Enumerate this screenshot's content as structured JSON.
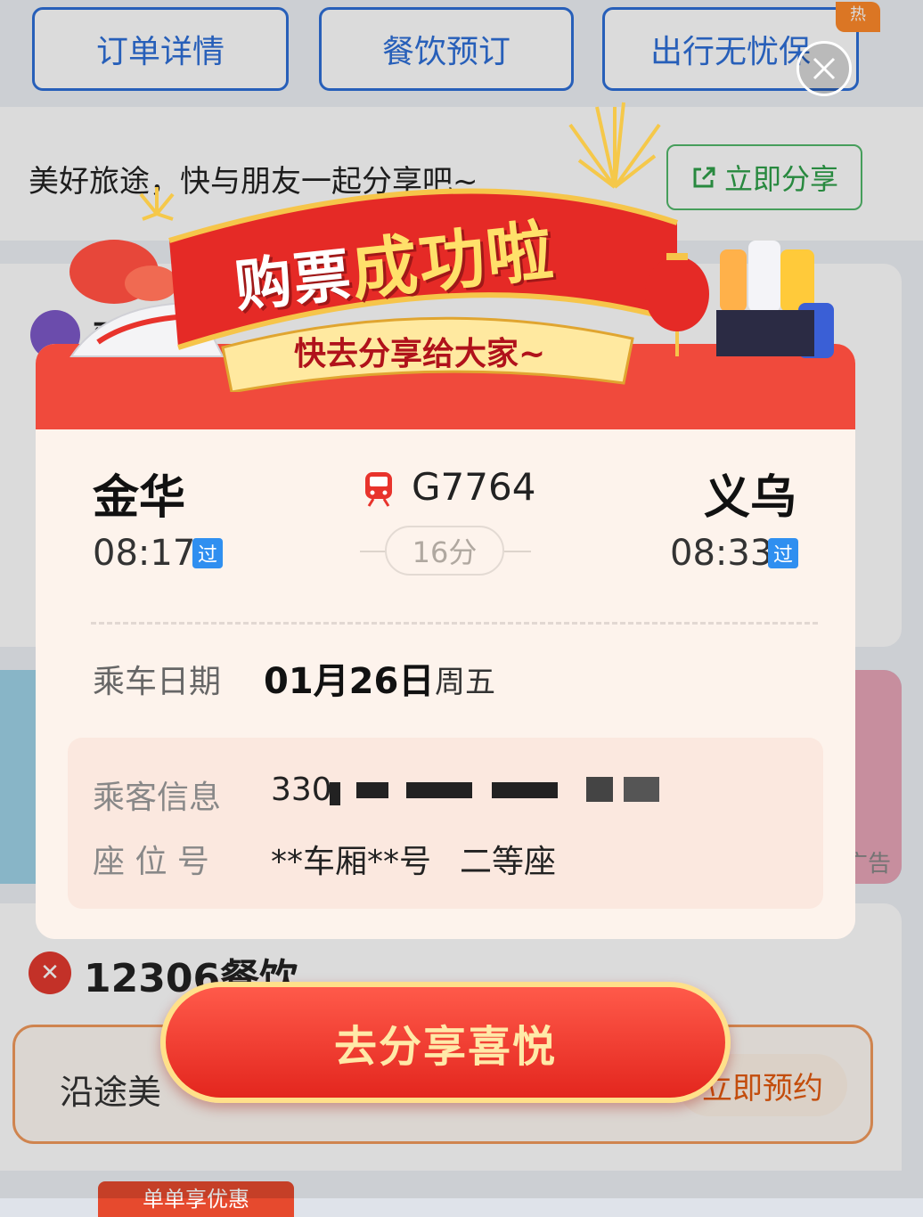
{
  "background": {
    "top_buttons": [
      "订单详情",
      "餐饮预订",
      "出行无忧保"
    ],
    "hot_badge": "热",
    "share_prompt": "美好旅途，快与朋友一起分享吧~",
    "share_button": "立即分享",
    "card1_title": "预",
    "card2_ad": "广告",
    "dining_title": "12306餐饮",
    "dining_label": "沿途美",
    "dining_book": "立即预约",
    "coupon_tab": "单单享优惠"
  },
  "banner": {
    "title_part1": "购票",
    "title_part2": "成功啦",
    "subtitle": "快去分享给大家~"
  },
  "trip": {
    "from_station": "金华",
    "from_time": "08:17",
    "from_tag": "过",
    "to_station": "义乌",
    "to_time": "08:33",
    "to_tag": "过",
    "train_no": "G7764",
    "duration": "16分",
    "date_label": "乘车日期",
    "date_value": "01月26日",
    "weekday": "周五"
  },
  "passenger": {
    "info_label": "乘客信息",
    "id_prefix": "330",
    "seat_label": "座 位 号",
    "seat_value": "**车厢**号",
    "seat_class": "二等座"
  },
  "cta": {
    "label": "去分享喜悦"
  },
  "colors": {
    "primary_blue": "#2e6fd8",
    "festive_red": "#f04a3c",
    "gold": "#ffe08a",
    "pass_tag": "#2f8ff0"
  }
}
